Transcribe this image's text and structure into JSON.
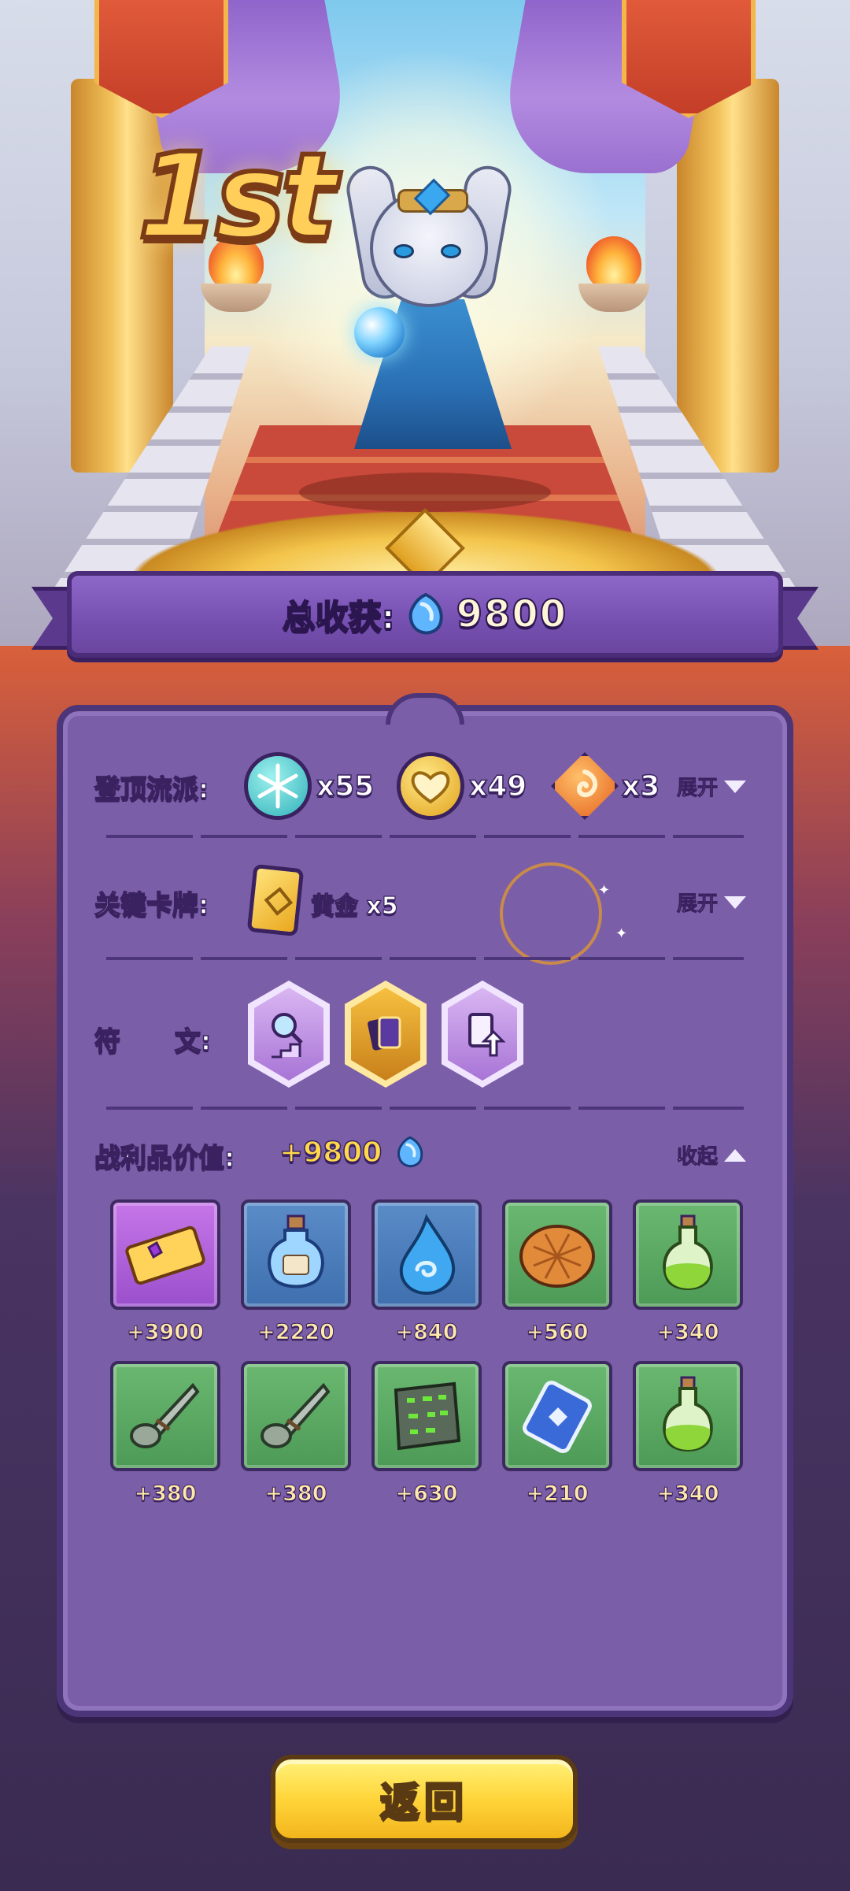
{
  "header": {
    "rank": "1st",
    "total_label": "总收获:",
    "total_value": "9800"
  },
  "colors": {
    "panel": "#7a5fa8",
    "panel_border": "#4d3579",
    "gold_text": "#ffd94a",
    "button": "#ffd53a"
  },
  "summit_school": {
    "label": "登顶流派:",
    "items": [
      {
        "icon": "snowflake-icon",
        "count": "x55",
        "color": "#3fc2c8"
      },
      {
        "icon": "heart-icon",
        "count": "x49",
        "color": "#f2c23a"
      },
      {
        "icon": "fire-swirl-icon",
        "count": "x3",
        "color": "#f08a2a"
      }
    ],
    "toggle_label": "展开"
  },
  "key_cards": {
    "label": "关键卡牌:",
    "card_name": "黄金",
    "card_count": "x5",
    "toggle_label": "展开"
  },
  "runes": {
    "label": "符      文:",
    "items": [
      {
        "icon": "magnify-stairs-rune-icon",
        "color": "#c89be8"
      },
      {
        "icon": "card-stack-rune-icon",
        "color": "#e6a82a"
      },
      {
        "icon": "card-upgrade-rune-icon",
        "color": "#c89be8"
      }
    ]
  },
  "loot": {
    "label": "战利品价值:",
    "value": "+9800",
    "toggle_label": "收起",
    "items": [
      {
        "icon": "vip-ticket-icon",
        "value": "+3900",
        "rarity": "purple"
      },
      {
        "icon": "potion-jar-icon",
        "value": "+2220",
        "rarity": "blue"
      },
      {
        "icon": "water-drop-icon",
        "value": "+840",
        "rarity": "blue"
      },
      {
        "icon": "bread-icon",
        "value": "+560",
        "rarity": "green"
      },
      {
        "icon": "green-potion-icon",
        "value": "+340",
        "rarity": "green"
      },
      {
        "icon": "stone-drill-icon",
        "value": "+380",
        "rarity": "green"
      },
      {
        "icon": "stone-drill-icon",
        "value": "+380",
        "rarity": "green"
      },
      {
        "icon": "rune-tablet-icon",
        "value": "+630",
        "rarity": "green"
      },
      {
        "icon": "blue-card-icon",
        "value": "+210",
        "rarity": "green"
      },
      {
        "icon": "green-potion-icon",
        "value": "+340",
        "rarity": "green"
      }
    ]
  },
  "back_button": {
    "label": "返回"
  }
}
